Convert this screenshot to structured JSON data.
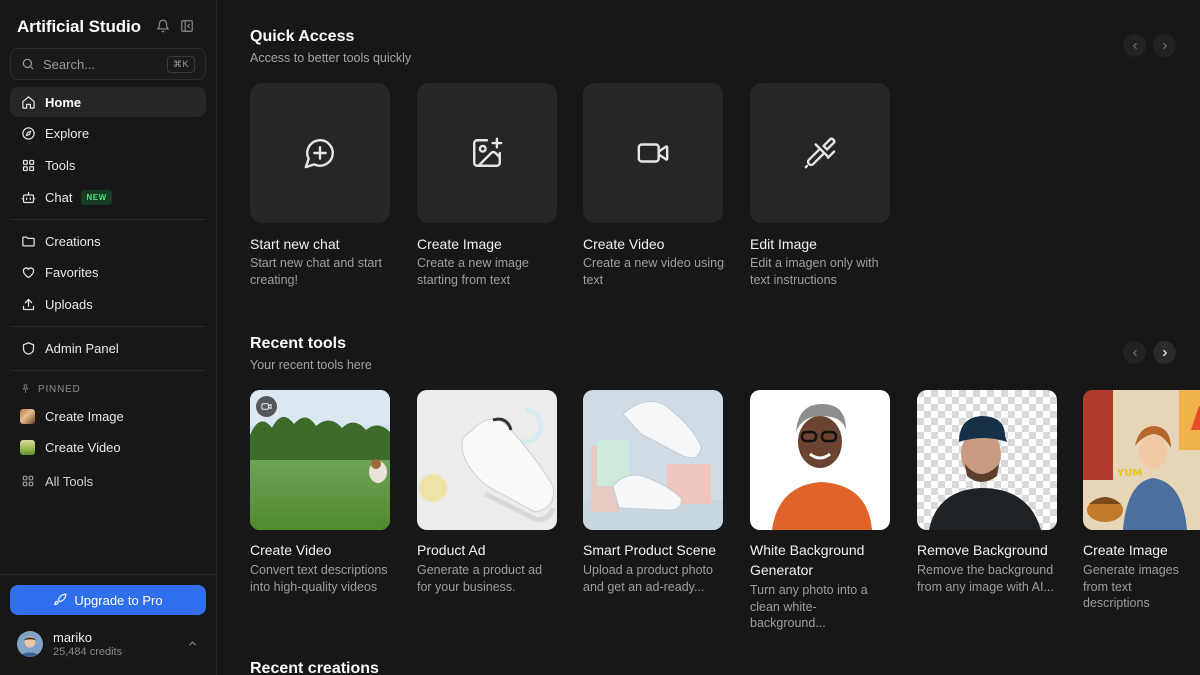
{
  "sidebar": {
    "brand": "Artificial Studio",
    "search": {
      "placeholder": "Search...",
      "shortcut": "⌘K"
    },
    "nav": [
      {
        "label": "Home",
        "icon": "home-icon",
        "active": true
      },
      {
        "label": "Explore",
        "icon": "compass-icon"
      },
      {
        "label": "Tools",
        "icon": "grid-icon"
      },
      {
        "label": "Chat",
        "icon": "bot-icon",
        "badge": "NEW"
      }
    ],
    "library": [
      {
        "label": "Creations",
        "icon": "folder-icon"
      },
      {
        "label": "Favorites",
        "icon": "heart-icon"
      },
      {
        "label": "Uploads",
        "icon": "upload-icon"
      }
    ],
    "admin": {
      "label": "Admin Panel",
      "icon": "shield-icon"
    },
    "pinned_header": "PINNED",
    "pinned": [
      {
        "label": "Create Image"
      },
      {
        "label": "Create Video"
      }
    ],
    "all_tools": "All Tools",
    "upgrade": "Upgrade to Pro",
    "user": {
      "name": "mariko",
      "credits": "25,484 credits"
    }
  },
  "quick_access": {
    "title": "Quick Access",
    "subtitle": "Access to better tools quickly",
    "cards": [
      {
        "title": "Start new chat",
        "desc": "Start new chat and start creating!",
        "icon": "chat-plus-icon"
      },
      {
        "title": "Create Image",
        "desc": "Create a new image starting from text",
        "icon": "image-plus-icon"
      },
      {
        "title": "Create Video",
        "desc": "Create a new video using text",
        "icon": "video-camera-icon"
      },
      {
        "title": "Edit Image",
        "desc": "Edit a imagen only with text instructions",
        "icon": "paintbrush-icon"
      }
    ]
  },
  "recent_tools": {
    "title": "Recent tools",
    "subtitle": "Your recent tools here",
    "cards": [
      {
        "title": "Create Video",
        "desc": "Convert text descriptions into high-quality videos"
      },
      {
        "title": "Product Ad",
        "desc": "Generate a product ad for your business."
      },
      {
        "title": "Smart Product Scene",
        "desc": "Upload a product photo and get an ad-ready..."
      },
      {
        "title": "White Background Generator",
        "desc": "Turn any photo into a clean white-background..."
      },
      {
        "title": "Remove Background",
        "desc": "Remove the background from any image with AI..."
      },
      {
        "title": "Create Image",
        "desc": "Generate images from text descriptions"
      }
    ]
  },
  "recent_creations": {
    "title": "Recent creations"
  },
  "colors": {
    "accent": "#2f6feb",
    "background": "#171717",
    "card": "#262626",
    "new_badge": "#4ade80"
  }
}
